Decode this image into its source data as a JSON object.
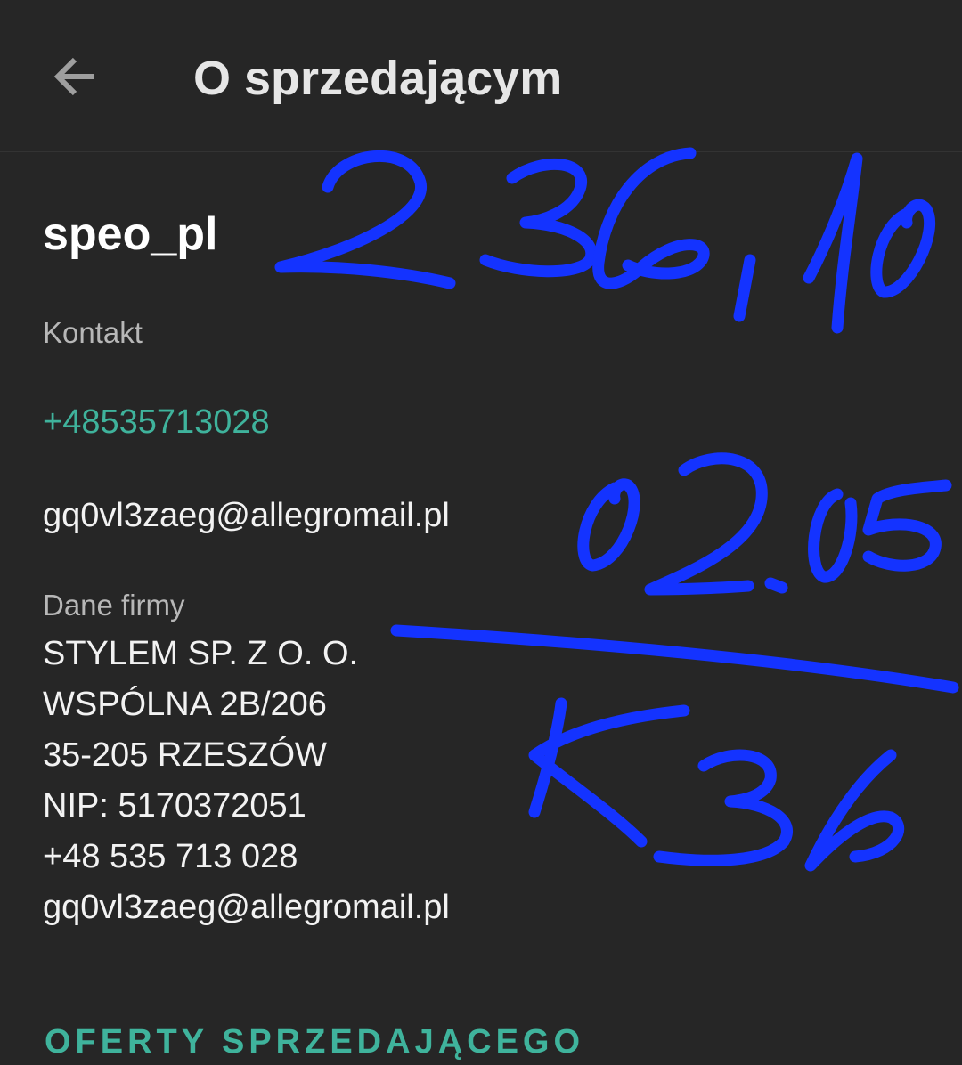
{
  "app_bar": {
    "back_icon": "arrow-left-icon",
    "title": "O sprzedającym"
  },
  "seller": {
    "name": "speo_pl"
  },
  "contact": {
    "label": "Kontakt",
    "phone": "+48535713028",
    "email": "gq0vl3zaeg@allegromail.pl"
  },
  "company": {
    "label": "Dane firmy",
    "lines": [
      "STYLEM SP. Z O. O.",
      "WSPÓLNA 2B/206",
      "35-205 RZESZÓW",
      "NIP: 5170372051",
      "+48 535 713 028",
      "gq0vl3zaeg@allegromail.pl"
    ]
  },
  "offers_link": "OFERTY SPRZEDAJĄCEGO",
  "handwritten_notes": [
    "236,10",
    "02.05",
    "K36"
  ],
  "colors": {
    "background": "#262626",
    "accent": "#3fb39c",
    "annotation_ink": "#1433ff"
  }
}
